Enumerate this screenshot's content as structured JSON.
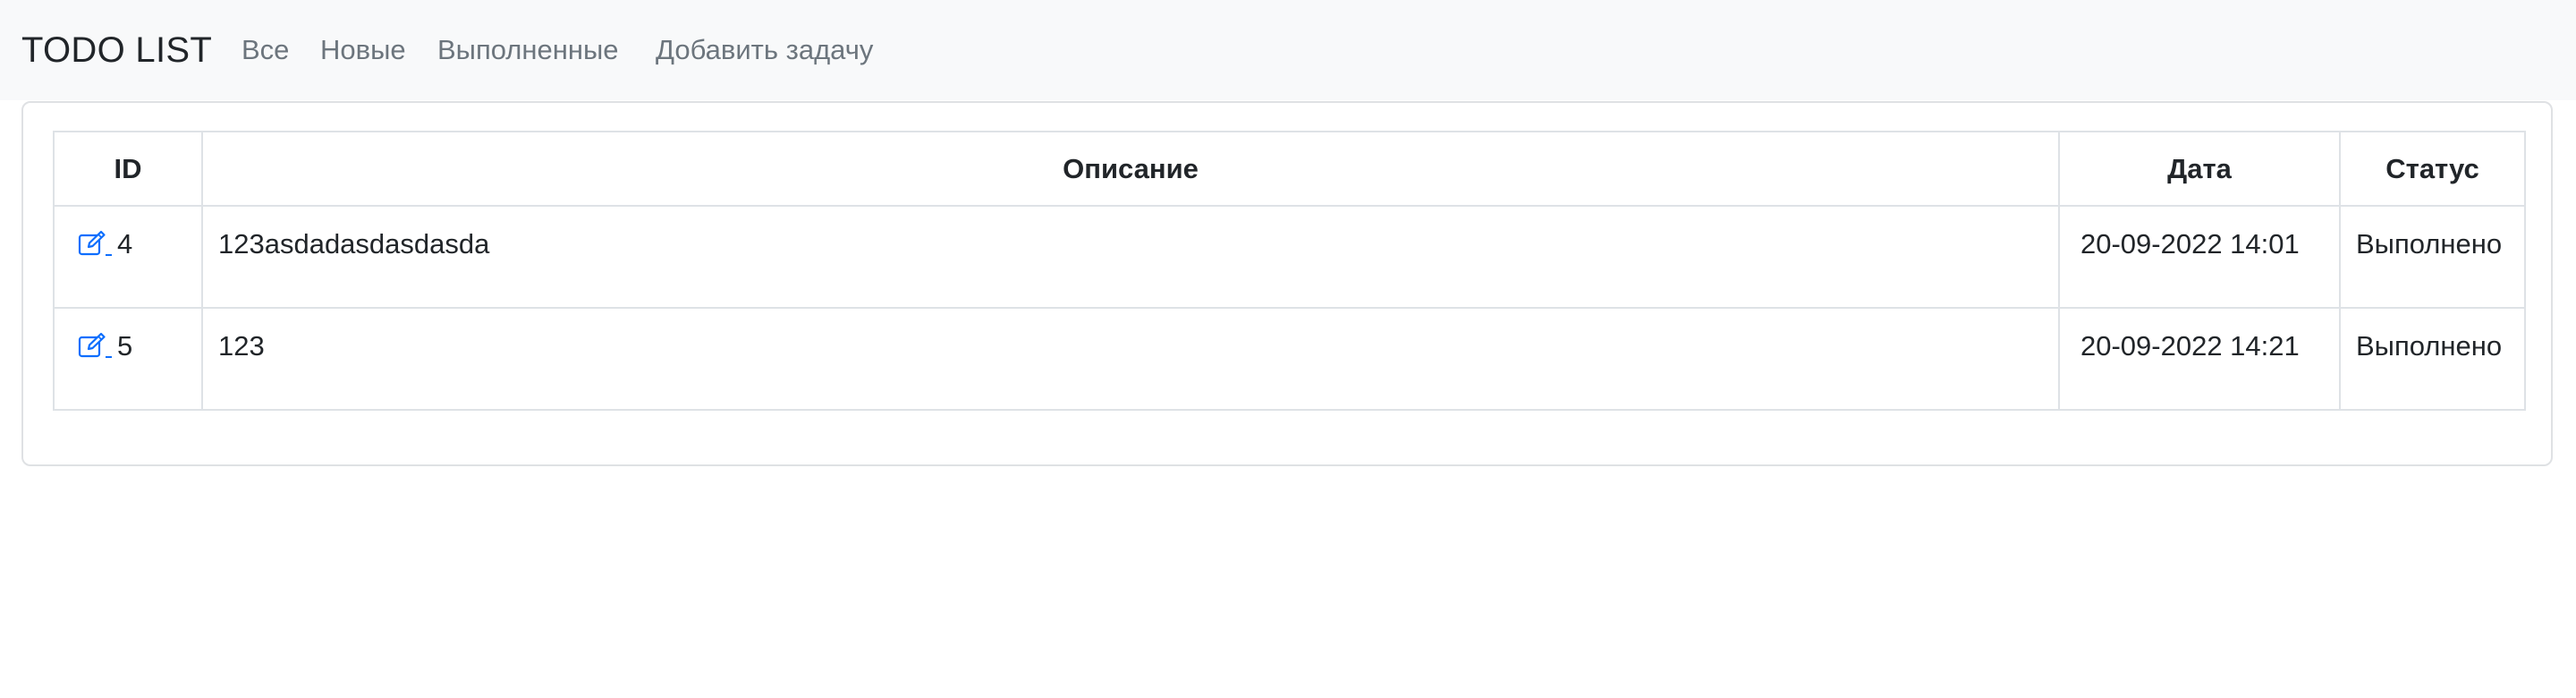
{
  "navbar": {
    "brand": "TODO LIST",
    "links": [
      "Все",
      "Новые",
      "Выполненные",
      "Добавить задачу"
    ]
  },
  "table": {
    "headers": {
      "id": "ID",
      "description": "Описание",
      "date": "Дата",
      "status": "Статус"
    },
    "rows": [
      {
        "id": "4",
        "description": "123asdadasdasdasda",
        "date": "20-09-2022 14:01",
        "status": "Выполнено",
        "edit_icon": "edit-icon"
      },
      {
        "id": "5",
        "description": "123",
        "date": "20-09-2022 14:21",
        "status": "Выполнено",
        "edit_icon": "edit-icon"
      }
    ]
  },
  "colors": {
    "navbar_bg": "#f8f9fa",
    "link": "#6c757d",
    "accent": "#0d6efd",
    "border": "#dee2e6"
  }
}
